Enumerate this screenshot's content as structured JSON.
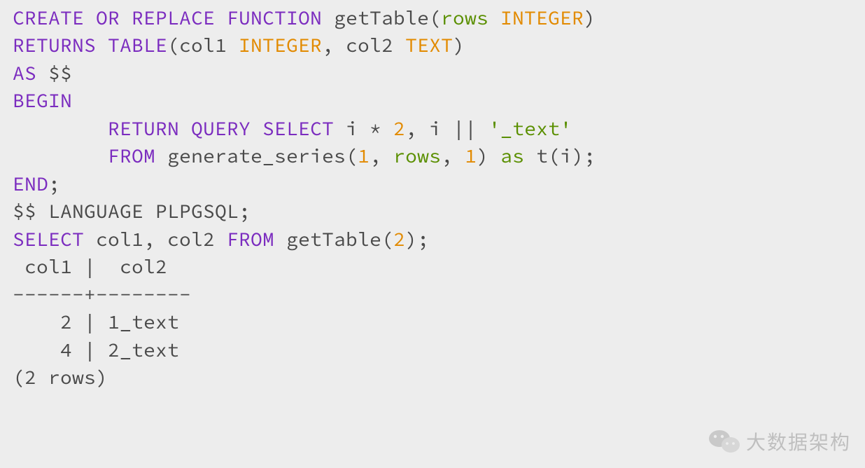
{
  "code": {
    "l1": {
      "kw": "CREATE OR REPLACE FUNCTION",
      "fn": " getTable(",
      "arg": "rows ",
      "ty": "INTEGER",
      "close": ")"
    },
    "l2": {
      "kw": "RETURNS TABLE",
      "open": "(col1 ",
      "ty1": "INTEGER",
      "mid": ", col2 ",
      "ty2": "TEXT",
      "close": ")"
    },
    "l3": {
      "kw": "AS",
      "rest": " $$"
    },
    "l4": {
      "kw": "BEGIN"
    },
    "l5": {
      "indent": "        ",
      "kw": "RETURN QUERY SELECT",
      "a": " i * ",
      "n1": "2",
      "b": ", i || ",
      "str": "'_text'"
    },
    "l6": {
      "indent": "        ",
      "kw": "FROM",
      "a": " generate_series(",
      "n1": "1",
      "c1": ", ",
      "id": "rows",
      "c2": ", ",
      "n2": "1",
      "b": ") ",
      "as": "as",
      "c": " t(i);"
    },
    "l7": {
      "kw": "END",
      "rest": ";"
    },
    "l8": {
      "txt": "$$ LANGUAGE PLPGSQL;"
    },
    "l9": {
      "kw1": "SELECT",
      "a": " col1, col2 ",
      "kw2": "FROM",
      "b": " getTable(",
      "n": "2",
      "c": ");"
    }
  },
  "output": {
    "header": " col1 |  col2  ",
    "sep": "------+--------",
    "row1": "    2 | 1_text",
    "row2": "    4 | 2_text",
    "footer": "(2 rows)"
  },
  "watermark": {
    "text": "大数据架构"
  }
}
